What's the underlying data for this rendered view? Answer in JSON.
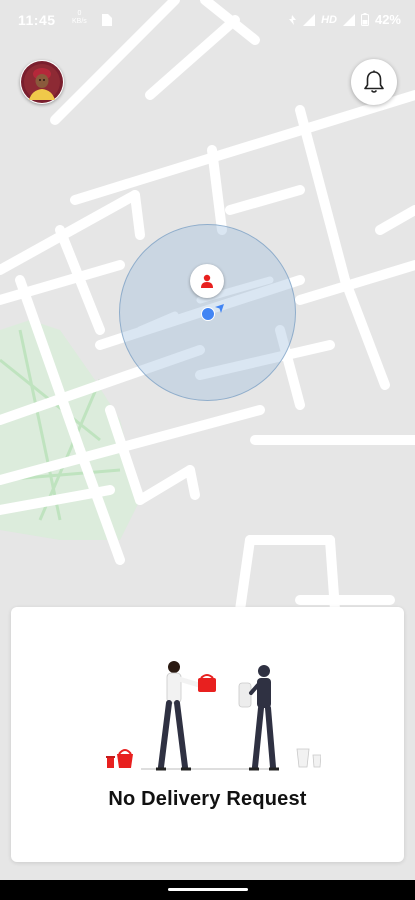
{
  "status_bar": {
    "time": "11:45",
    "net_rate": "0",
    "net_unit": "KB/s",
    "network_type": "HD",
    "battery": "42%"
  },
  "map": {
    "background_color": "#e6e6e6",
    "road_color": "#ffffff",
    "park_color": "#d9ecd9",
    "search_radius_color": "#9dbedc",
    "location_color": "#4285f4"
  },
  "icons": {
    "profile": "avatar",
    "notifications": "bell-icon",
    "driver_marker": "person-icon",
    "heading": "heading-arrow-icon"
  },
  "delivery_card": {
    "message": "No Delivery Request",
    "accent_color": "#e8201f"
  }
}
